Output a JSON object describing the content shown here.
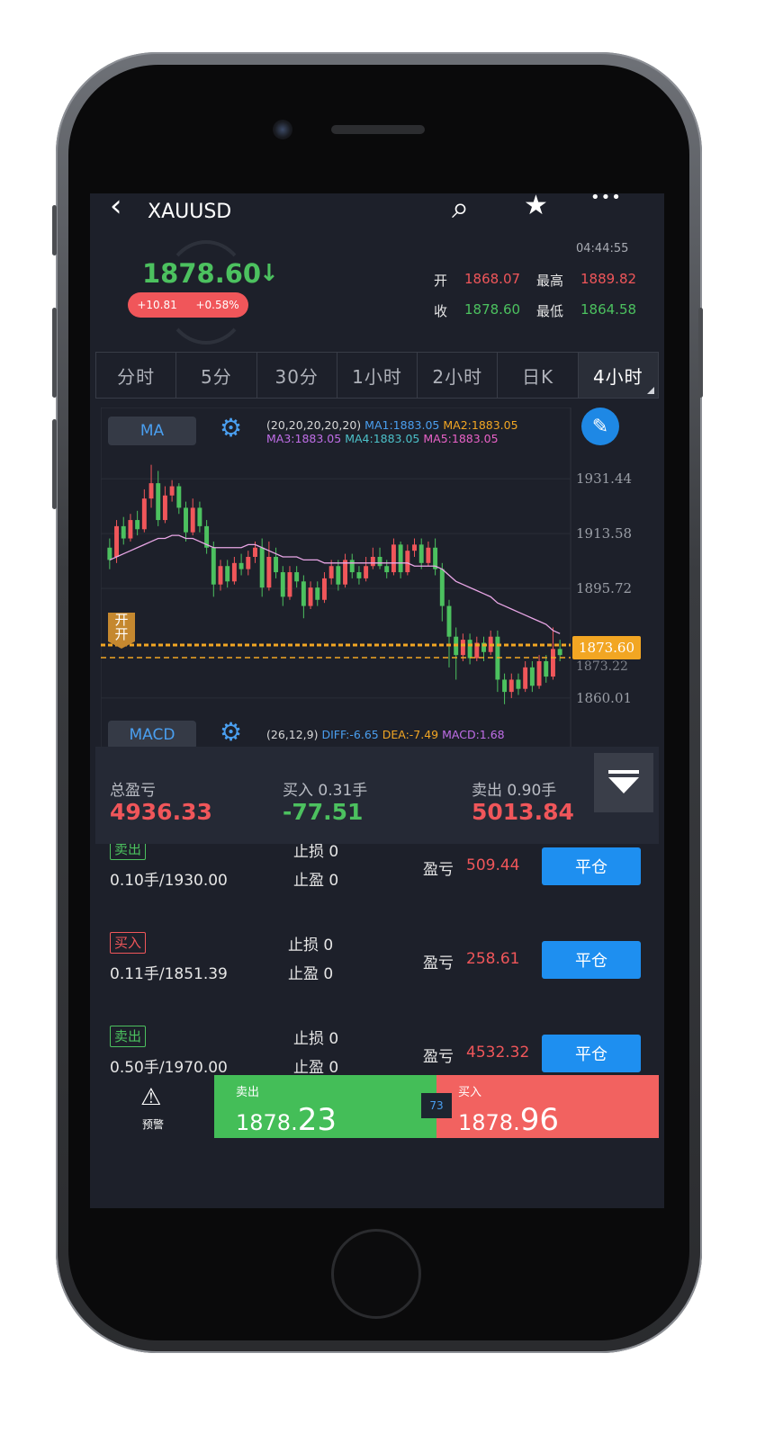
{
  "header": {
    "back_glyph": "‹",
    "symbol": "XAUUSD",
    "search_glyph": "⌕",
    "star_glyph": "★",
    "more_glyph": "•••"
  },
  "quote": {
    "last": "1878.60",
    "arrow": "↓",
    "change": "+10.81",
    "change_pct": "+0.58%",
    "time": "04:44:55",
    "open_label": "开",
    "open": "1868.07",
    "high_label": "最高",
    "high": "1889.82",
    "close_label": "收",
    "close": "1878.60",
    "low_label": "最低",
    "low": "1864.58"
  },
  "tabs": [
    {
      "label": "分时"
    },
    {
      "label": "5分"
    },
    {
      "label": "30分"
    },
    {
      "label": "1小时"
    },
    {
      "label": "2小时"
    },
    {
      "label": "日K"
    },
    {
      "label": "4小时"
    }
  ],
  "chart": {
    "ma_button": "MA",
    "ma_params": "(20,20,20,20,20)",
    "ma1": "MA1:1883.05",
    "ma2": "MA2:1883.05",
    "ma3": "MA3:1883.05",
    "ma4": "MA4:1883.05",
    "ma5": "MA5:1883.05",
    "macd_button": "MACD",
    "macd_params": "(26,12,9)",
    "diff": "DIFF:-6.65",
    "dea": "DEA:-7.49",
    "macd": "MACD:1.68",
    "open_marker": "开\n开",
    "current_price_label": "1873.60",
    "hidden_price_label": "1873.22",
    "pen_glyph": "✎",
    "gear_glyph": "⚙",
    "colors": {
      "up": "#f0565a",
      "down": "#4cc15f",
      "ma": "#e9a6e6",
      "accent": "#1e88e5",
      "dash": "#f2a623"
    }
  },
  "chart_data": {
    "type": "candlestick",
    "y_ticks": [
      "1931.44",
      "1913.58",
      "1895.72",
      "1860.01"
    ],
    "ylim": [
      1855,
      1940
    ],
    "candles": [
      [
        1909,
        1905,
        1912,
        1902
      ],
      [
        1906,
        1916,
        1918,
        1904
      ],
      [
        1916,
        1912,
        1919,
        1910
      ],
      [
        1912,
        1918,
        1920,
        1911
      ],
      [
        1918,
        1915,
        1921,
        1913
      ],
      [
        1915,
        1925,
        1928,
        1914
      ],
      [
        1925,
        1930,
        1936,
        1922
      ],
      [
        1930,
        1918,
        1934,
        1916
      ],
      [
        1918,
        1926,
        1929,
        1917
      ],
      [
        1926,
        1929,
        1931,
        1924
      ],
      [
        1929,
        1922,
        1930,
        1920
      ],
      [
        1922,
        1914,
        1924,
        1911
      ],
      [
        1914,
        1922,
        1925,
        1913
      ],
      [
        1922,
        1916,
        1924,
        1914
      ],
      [
        1916,
        1909,
        1918,
        1907
      ],
      [
        1909,
        1897,
        1911,
        1893
      ],
      [
        1897,
        1903,
        1905,
        1895
      ],
      [
        1903,
        1898,
        1905,
        1896
      ],
      [
        1898,
        1904,
        1906,
        1897
      ],
      [
        1904,
        1902,
        1907,
        1900
      ],
      [
        1902,
        1906,
        1908,
        1900
      ],
      [
        1906,
        1909,
        1911,
        1904
      ],
      [
        1909,
        1896,
        1912,
        1893
      ],
      [
        1896,
        1906,
        1911,
        1895
      ],
      [
        1906,
        1901,
        1909,
        1899
      ],
      [
        1901,
        1893,
        1903,
        1890
      ],
      [
        1893,
        1901,
        1903,
        1892
      ],
      [
        1901,
        1898,
        1903,
        1896
      ],
      [
        1898,
        1890,
        1900,
        1886
      ],
      [
        1890,
        1896,
        1898,
        1889
      ],
      [
        1896,
        1892,
        1898,
        1890
      ],
      [
        1892,
        1899,
        1901,
        1891
      ],
      [
        1899,
        1903,
        1905,
        1897
      ],
      [
        1903,
        1897,
        1905,
        1895
      ],
      [
        1897,
        1905,
        1907,
        1896
      ],
      [
        1905,
        1901,
        1907,
        1899
      ],
      [
        1901,
        1899,
        1903,
        1897
      ],
      [
        1899,
        1903,
        1906,
        1898
      ],
      [
        1903,
        1906,
        1909,
        1902
      ],
      [
        1906,
        1903,
        1909,
        1902
      ],
      [
        1903,
        1901,
        1905,
        1899
      ],
      [
        1901,
        1910,
        1912,
        1900
      ],
      [
        1910,
        1901,
        1911,
        1899
      ],
      [
        1901,
        1908,
        1910,
        1900
      ],
      [
        1908,
        1910,
        1912,
        1906
      ],
      [
        1910,
        1904,
        1912,
        1902
      ],
      [
        1904,
        1909,
        1911,
        1903
      ],
      [
        1909,
        1902,
        1912,
        1900
      ],
      [
        1902,
        1890,
        1904,
        1885
      ],
      [
        1890,
        1880,
        1892,
        1870
      ],
      [
        1880,
        1874,
        1883,
        1866
      ],
      [
        1874,
        1879,
        1881,
        1872
      ],
      [
        1879,
        1873,
        1881,
        1871
      ],
      [
        1873,
        1878,
        1880,
        1872
      ],
      [
        1878,
        1875,
        1880,
        1872
      ],
      [
        1875,
        1880,
        1882,
        1874
      ],
      [
        1880,
        1866,
        1882,
        1862
      ],
      [
        1866,
        1862,
        1868,
        1858
      ],
      [
        1862,
        1866,
        1868,
        1860
      ],
      [
        1866,
        1863,
        1868,
        1861
      ],
      [
        1863,
        1870,
        1872,
        1862
      ],
      [
        1870,
        1864,
        1872,
        1862
      ],
      [
        1864,
        1872,
        1874,
        1863
      ],
      [
        1872,
        1867,
        1874,
        1865
      ],
      [
        1867,
        1876,
        1883,
        1866
      ],
      [
        1876,
        1874,
        1879,
        1872
      ]
    ],
    "ma": [
      1905,
      1906,
      1907,
      1908,
      1909,
      1910,
      1911,
      1912,
      1912,
      1913,
      1913,
      1912,
      1912,
      1911,
      1910,
      1909,
      1909,
      1909,
      1909,
      1909,
      1910,
      1910,
      1909,
      1908,
      1907,
      1906,
      1906,
      1906,
      1905,
      1905,
      1905,
      1904,
      1904,
      1904,
      1904,
      1904,
      1904,
      1904,
      1904,
      1904,
      1904,
      1904,
      1904,
      1904,
      1903,
      1903,
      1903,
      1903,
      1902,
      1900,
      1898,
      1897,
      1896,
      1895,
      1894,
      1893,
      1891,
      1890,
      1889,
      1888,
      1887,
      1886,
      1885,
      1884,
      1882,
      1881
    ]
  },
  "summary": {
    "total_label": "总盈亏",
    "total_value": "4936.33",
    "buy_label": "买入 0.31手",
    "buy_value": "-77.51",
    "sell_label": "卖出 0.90手",
    "sell_value": "5013.84",
    "collapse_glyph": "⏷"
  },
  "positions": [
    {
      "side": "卖出",
      "lots": "0.10手/1930.00",
      "sl_label": "止损",
      "sl": "0",
      "tp_label": "止盈",
      "tp": "0",
      "pnl_label": "盈亏",
      "pnl": "509.44",
      "close": "平仓"
    },
    {
      "side": "买入",
      "lots": "0.11手/1851.39",
      "sl_label": "止损",
      "sl": "0",
      "tp_label": "止盈",
      "tp": "0",
      "pnl_label": "盈亏",
      "pnl": "258.61",
      "close": "平仓"
    },
    {
      "side": "卖出",
      "lots": "0.50手/1970.00",
      "sl_label": "止损",
      "sl": "0",
      "tp_label": "止盈",
      "tp": "0",
      "pnl_label": "盈亏",
      "pnl": "4532.32",
      "close": "平仓"
    }
  ],
  "bottom": {
    "alarm_label": "预警",
    "alarm_glyph": "⚠",
    "sell_label": "卖出",
    "sell_small": "1878.",
    "sell_big": "23",
    "spread": "73",
    "buy_label": "买入",
    "buy_small": "1878.",
    "buy_big": "96"
  }
}
